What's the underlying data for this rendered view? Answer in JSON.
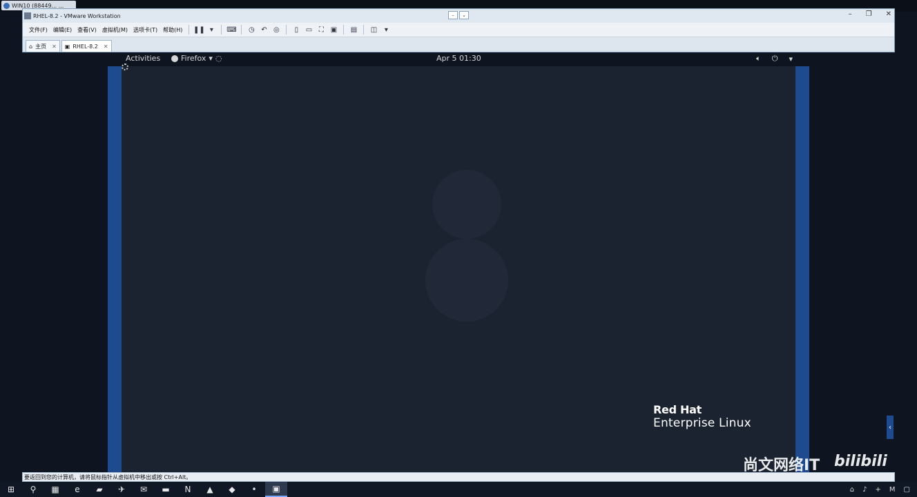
{
  "remote": {
    "tag_label": "WIN10 (88449... ..."
  },
  "vm": {
    "title": "RHEL-8.2 - VMware Workstation",
    "window_controls": [
      "–",
      "❐",
      "✕"
    ],
    "menu": [
      "文件(F)",
      "编辑(E)",
      "查看(V)",
      "虚拟机(M)",
      "选项卡(T)",
      "帮助(H)"
    ],
    "toolbar_icons": [
      "pause-icon",
      "dropdown-icon",
      "send-keys-icon",
      "snapshot-icon",
      "revert-icon",
      "snapshot-manager-icon",
      "fit-guest-icon",
      "fit-window-icon",
      "full-screen-icon",
      "unity-icon",
      "console-icon",
      "stretch-icon"
    ],
    "tabs": [
      {
        "label": "主页",
        "active": false
      },
      {
        "label": "RHEL-8.2",
        "active": true
      }
    ],
    "status_text": "要返回到您的计算机，请将鼠标指针从虚拟机中移出或按 Ctrl+Alt。"
  },
  "gnome": {
    "activities": "Activities",
    "app_menu": "Firefox",
    "clock": "Apr 5  01:30",
    "tray": [
      "volume-icon",
      "power-icon",
      "chevron-down-icon"
    ]
  },
  "desktop": {
    "brand_line1": "Red Hat",
    "brand_line2": "Enterprise Linux"
  },
  "overlay": {
    "watermark": "尚文网络IT",
    "bili_logo": "bilibili"
  },
  "taskbar": {
    "items": [
      "start-icon",
      "search-icon",
      "task-view-icon",
      "edge-icon",
      "app-icon",
      "thunderbird-icon",
      "mail-icon",
      "folder-icon",
      "onenote-icon",
      "app2-icon",
      "app3-icon",
      "app4-icon",
      "vmware-icon"
    ]
  }
}
